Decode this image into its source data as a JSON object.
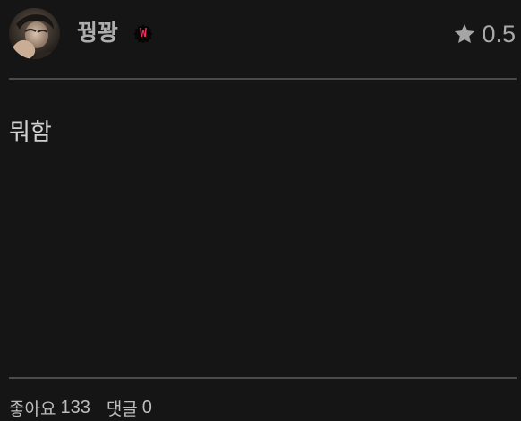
{
  "user": {
    "name": "꿩꽝",
    "badge_letter": "W",
    "avatar_icon": "user-avatar-photo"
  },
  "rating": {
    "icon": "star-icon",
    "value": "0.5"
  },
  "review": {
    "text": "뭐함"
  },
  "footer": {
    "likes_label": "좋아요",
    "likes_count": "133",
    "comments_label": "댓글",
    "comments_count": "0"
  },
  "colors": {
    "background": "#151515",
    "badge_accent": "#e8315b",
    "divider": "#4a4a4a"
  }
}
